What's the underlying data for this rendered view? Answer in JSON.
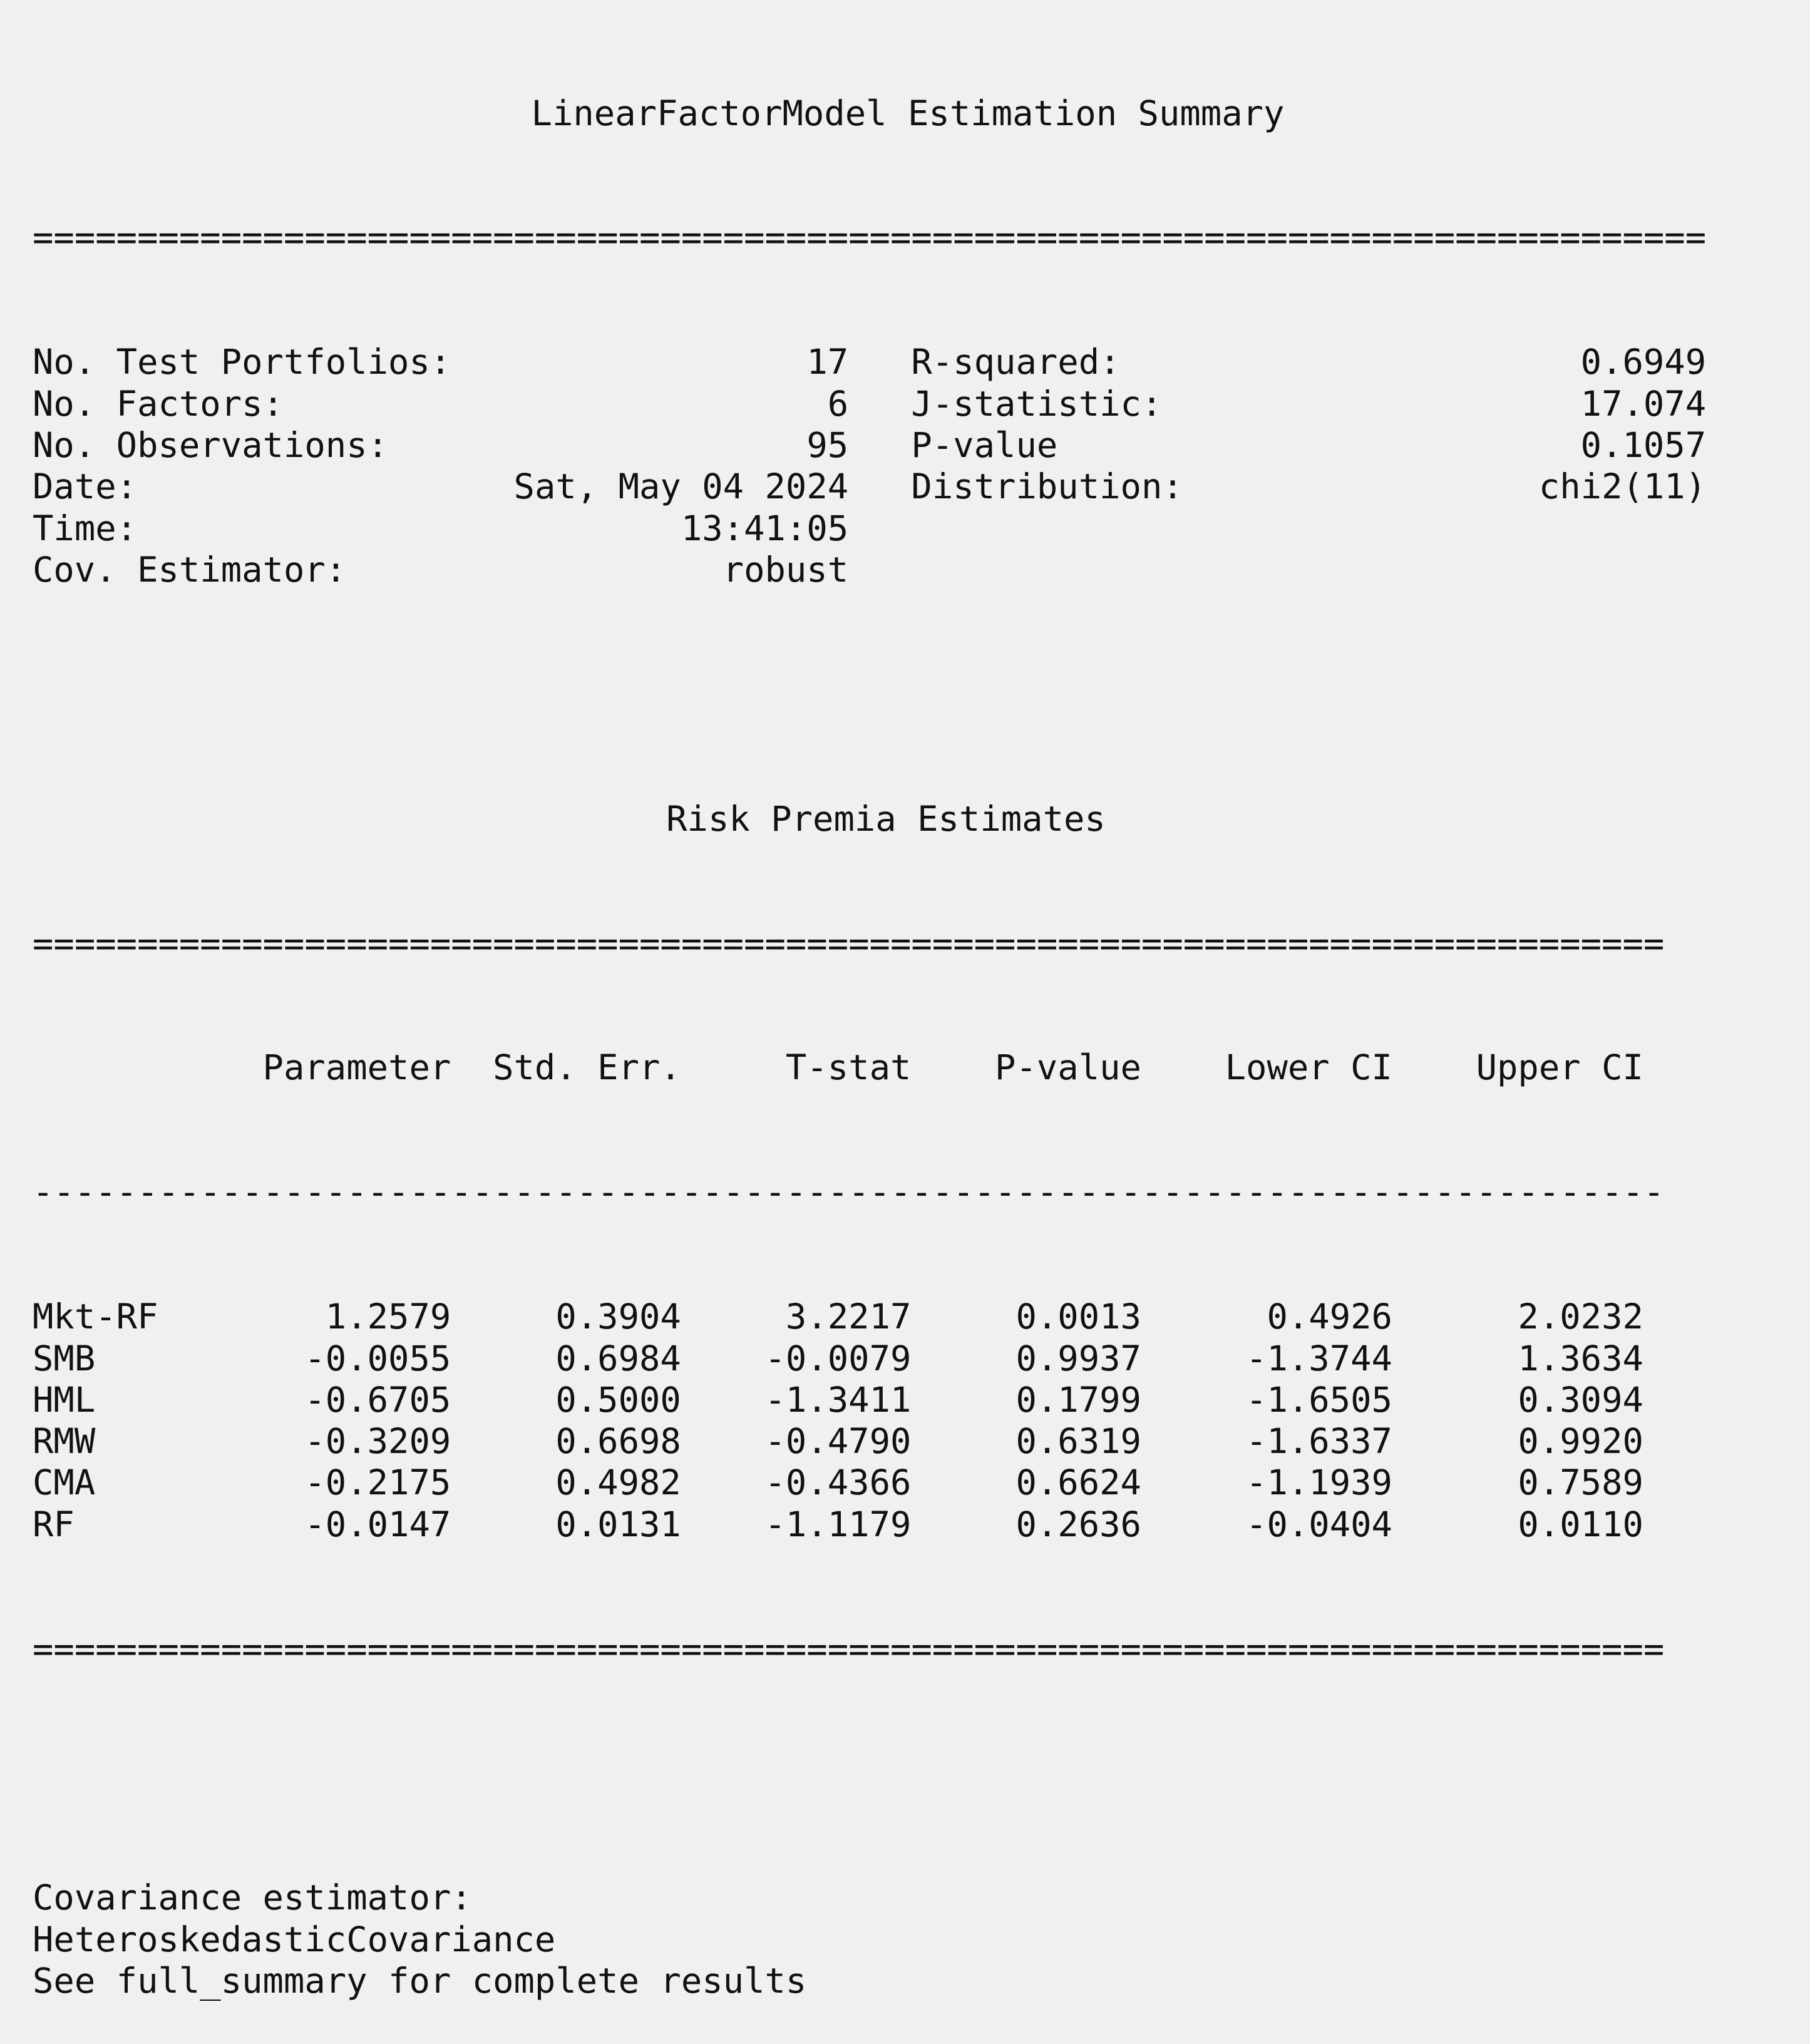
{
  "summary_title": "LinearFactorModel Estimation Summary",
  "separator_wide": "================================================================================",
  "summary_rows": [
    {
      "left_label": "No. Test Portfolios:",
      "left_value": "17",
      "right_label": "R-squared:",
      "right_value": "0.6949"
    },
    {
      "left_label": "No. Factors:",
      "left_value": "6",
      "right_label": "J-statistic:",
      "right_value": "17.074"
    },
    {
      "left_label": "No. Observations:",
      "left_value": "95",
      "right_label": "P-value",
      "right_value": "0.1057"
    },
    {
      "left_label": "Date:",
      "left_value": "Sat, May 04 2024",
      "right_label": "Distribution:",
      "right_value": "chi2(11)"
    },
    {
      "left_label": "Time:",
      "left_value": "13:41:05",
      "right_label": "",
      "right_value": ""
    },
    {
      "left_label": "Cov. Estimator:",
      "left_value": "robust",
      "right_label": "",
      "right_value": ""
    }
  ],
  "risk_premia_title": "Risk Premia Estimates",
  "separator_table": "==============================================================================",
  "separator_dash": "------------------------------------------------------------------------------",
  "columns": [
    "",
    "Parameter",
    "Std. Err.",
    "T-stat",
    "P-value",
    "Lower CI",
    "Upper CI"
  ],
  "rows": [
    [
      "Mkt-RF",
      "1.2579",
      "0.3904",
      "3.2217",
      "0.0013",
      "0.4926",
      "2.0232"
    ],
    [
      "SMB",
      "-0.0055",
      "0.6984",
      "-0.0079",
      "0.9937",
      "-1.3744",
      "1.3634"
    ],
    [
      "HML",
      "-0.6705",
      "0.5000",
      "-1.3411",
      "0.1799",
      "-1.6505",
      "0.3094"
    ],
    [
      "RMW",
      "-0.3209",
      "0.6698",
      "-0.4790",
      "0.6319",
      "-1.6337",
      "0.9920"
    ],
    [
      "CMA",
      "-0.2175",
      "0.4982",
      "-0.4366",
      "0.6624",
      "-1.1939",
      "0.7589"
    ],
    [
      "RF",
      "-0.0147",
      "0.0131",
      "-1.1179",
      "0.2636",
      "-0.0404",
      "0.0110"
    ]
  ],
  "notes": [
    "Covariance estimator:",
    "HeteroskedasticCovariance",
    "See full_summary for complete results"
  ]
}
